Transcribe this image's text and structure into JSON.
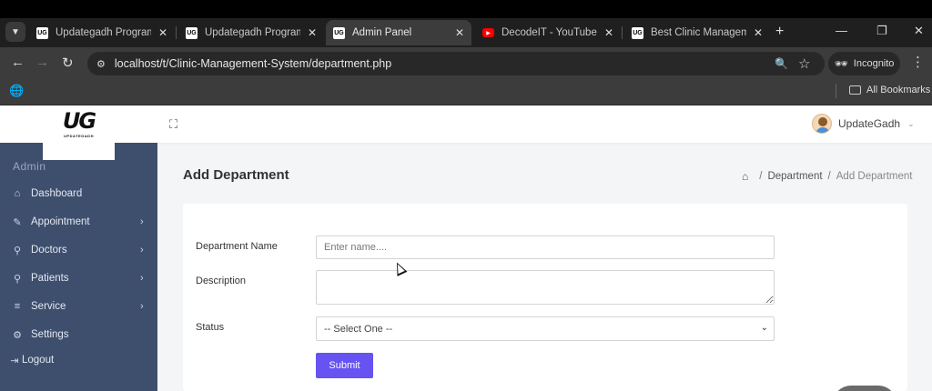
{
  "browser": {
    "tabs": [
      {
        "label": "Updategadh Programmin",
        "favicon": "UG"
      },
      {
        "label": "Updategadh Programmin",
        "favicon": "UG"
      },
      {
        "label": "Admin Panel",
        "favicon": "UG",
        "active": true
      },
      {
        "label": "DecodeIT - YouTube",
        "favicon": "youtube"
      },
      {
        "label": "Best Clinic Management",
        "favicon": "UG"
      }
    ],
    "url": "localhost/t/Clinic-Management-System/department.php",
    "incognito_label": "Incognito",
    "bookmarks_label": "All Bookmarks"
  },
  "header": {
    "logo_mark": "UG",
    "logo_text": "UPDATEGADH",
    "username": "UpdateGadh"
  },
  "sidebar": {
    "section_title": "Admin",
    "items": [
      {
        "label": "Dashboard",
        "icon": "home-icon",
        "has_submenu": false
      },
      {
        "label": "Appointment",
        "icon": "edit-icon",
        "has_submenu": true
      },
      {
        "label": "Doctors",
        "icon": "user-icon",
        "has_submenu": true
      },
      {
        "label": "Patients",
        "icon": "user-icon",
        "has_submenu": true
      },
      {
        "label": "Service",
        "icon": "list-icon",
        "has_submenu": true
      },
      {
        "label": "Settings",
        "icon": "gear-icon",
        "has_submenu": false
      },
      {
        "label": "Logout",
        "icon": "logout-icon",
        "has_submenu": false
      }
    ]
  },
  "main": {
    "title": "Add Department",
    "breadcrumb": {
      "item1": "Department",
      "item2": "Add Department"
    },
    "form": {
      "name_label": "Department Name",
      "name_placeholder": "Enter name....",
      "name_value": "",
      "description_label": "Description",
      "description_value": "",
      "status_label": "Status",
      "status_selected": "-- Select One --",
      "submit_label": "Submit"
    }
  },
  "colors": {
    "sidebar_bg": "#3e4f6e",
    "submit_bg": "#6753f1",
    "page_bg": "#f4f5f7"
  }
}
